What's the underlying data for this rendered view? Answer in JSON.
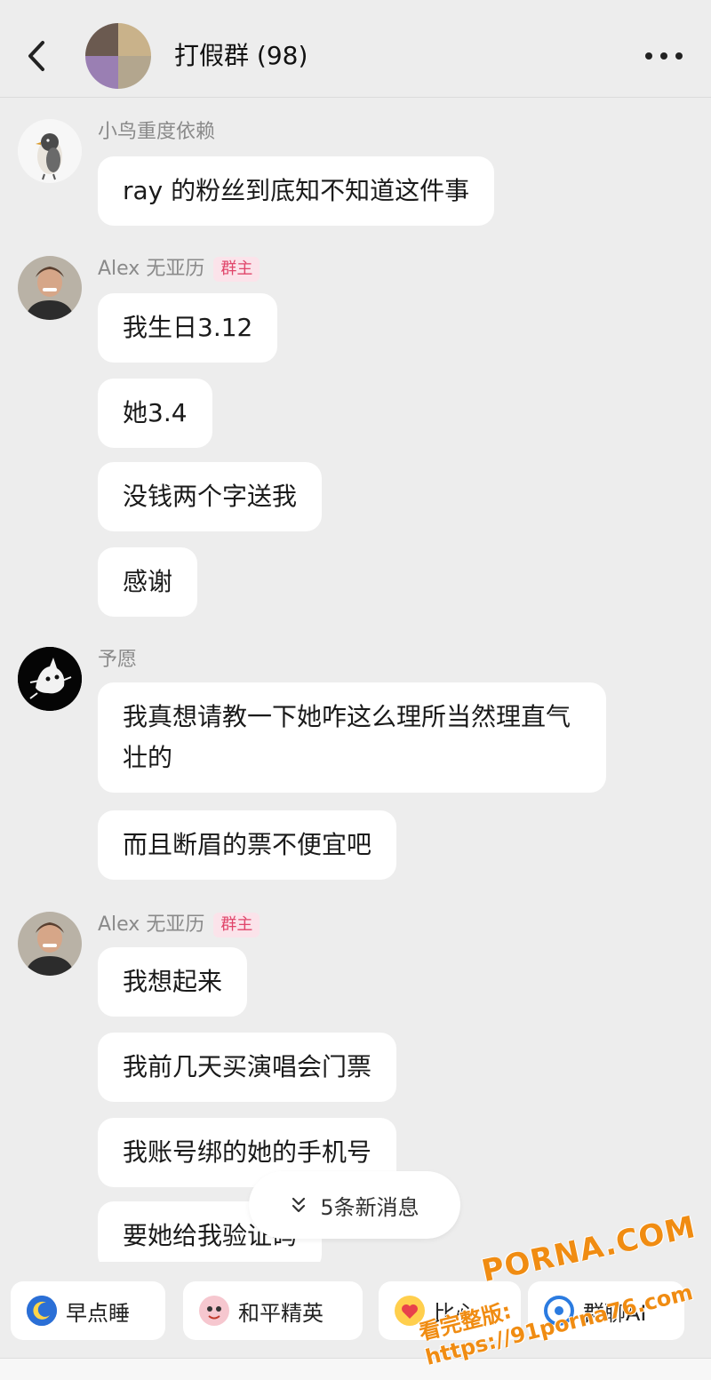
{
  "header": {
    "title": "打假群 (98)",
    "back_icon": "chevron-left-icon",
    "more_icon": "more-horizontal-icon"
  },
  "messages": [
    {
      "sender": "小鸟重度依赖",
      "badge": "",
      "bubbles": [
        "ray 的粉丝到底知不知道这件事"
      ]
    },
    {
      "sender": "Alex 无亚历",
      "badge": "群主",
      "bubbles": [
        "我生日3.12",
        "她3.4",
        "没钱两个字送我",
        "感谢"
      ]
    },
    {
      "sender": "予愿",
      "badge": "",
      "bubbles": [
        "我真想请教一下她咋这么理所当然理直气壮的",
        "而且断眉的票不便宜吧"
      ]
    },
    {
      "sender": "Alex 无亚历",
      "badge": "群主",
      "bubbles": [
        "我想起来",
        "我前几天买演唱会门票",
        "我账号绑的她的手机号",
        "要她给我验证码"
      ]
    }
  ],
  "new_messages": {
    "label": "5条新消息",
    "icon": "double-chevron-down-icon"
  },
  "quick_actions": [
    {
      "label": "早点睡",
      "icon": "moon-icon"
    },
    {
      "label": "和平精英",
      "icon": "game-icon"
    },
    {
      "label": "比心",
      "icon": "heart-hands-icon"
    },
    {
      "label": "群聊AI",
      "icon": "ai-icon"
    }
  ],
  "watermark": {
    "line1": "PORNA.COM",
    "line2": "看完整版: https://91porna76.com"
  },
  "colors": {
    "background": "#ededed",
    "bubble": "#ffffff",
    "badge_text": "#e0456a",
    "badge_bg": "#fbe3ea",
    "watermark": "#f08c12"
  }
}
